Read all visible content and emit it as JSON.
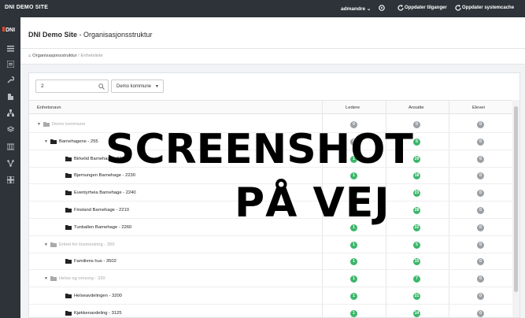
{
  "topbar": {
    "site": "DNI DEMO SITE",
    "user": "admandre ⌄",
    "update_access": "Oppdater tilganger",
    "update_cache": "Oppdater systemcache"
  },
  "sidebar": {
    "logo": "DNI"
  },
  "header": {
    "title_bold": "DNI Demo Site",
    "title_rest": " - Organisasjonsstruktur"
  },
  "breadcrumb": {
    "item1": "Organisasjonsstruktur",
    "separator": "/",
    "item2": "Enhetsliste"
  },
  "filter": {
    "search_value": "2",
    "select_value": "Demo kommune",
    "select_caret": "▼"
  },
  "table": {
    "headers": [
      "Enhetsnavn",
      "Ledere",
      "Ansatte",
      "Elever"
    ],
    "rows": [
      {
        "caret": "▼",
        "label": "Demo kommune",
        "muted": true,
        "ledere": "0",
        "ansatte": "0",
        "elever": "0",
        "ledere_green": false,
        "ansatte_green": false
      },
      {
        "caret": "▼",
        "label": "Barnehagene - 255",
        "muted": false,
        "ledere": "0",
        "ansatte": "6",
        "elever": "0",
        "ledere_green": false,
        "ansatte_green": true
      },
      {
        "caret": "",
        "label": "Birkelid Barnehage - 2270",
        "muted": false,
        "ledere": "1",
        "ansatte": "29",
        "elever": "0",
        "ledere_green": true,
        "ansatte_green": true
      },
      {
        "caret": "",
        "label": "Bjørnungen Barnehage - 2230",
        "muted": false,
        "ledere": "1",
        "ansatte": "18",
        "elever": "0",
        "ledere_green": true,
        "ansatte_green": true
      },
      {
        "caret": "",
        "label": "Eventyrheia Barnehage - 2240",
        "muted": false,
        "ledere": "1",
        "ansatte": "23",
        "elever": "0",
        "ledere_green": true,
        "ansatte_green": true
      },
      {
        "caret": "",
        "label": "Finsland Barnehage - 2210",
        "muted": false,
        "ledere": "1",
        "ansatte": "28",
        "elever": "0",
        "ledere_green": true,
        "ansatte_green": true
      },
      {
        "caret": "",
        "label": "Tunballen Barnehage - 2260",
        "muted": false,
        "ledere": "1",
        "ansatte": "22",
        "elever": "0",
        "ledere_green": true,
        "ansatte_green": true
      },
      {
        "caret": "▼",
        "label": "Enhet for livsmestring - 350",
        "muted": true,
        "ledere": "1",
        "ansatte": "5",
        "elever": "0",
        "ledere_green": true,
        "ansatte_green": true
      },
      {
        "caret": "",
        "label": "Familiens hus - 3502",
        "muted": false,
        "ledere": "1",
        "ansatte": "15",
        "elever": "0",
        "ledere_green": true,
        "ansatte_green": true
      },
      {
        "caret": "▼",
        "label": "Helse og omsorg - 320",
        "muted": true,
        "ledere": "1",
        "ansatte": "7",
        "elever": "0",
        "ledere_green": true,
        "ansatte_green": true
      },
      {
        "caret": "",
        "label": "Helseavdelingen - 3200",
        "muted": false,
        "ledere": "1",
        "ansatte": "21",
        "elever": "0",
        "ledere_green": true,
        "ansatte_green": true
      },
      {
        "caret": "",
        "label": "Kjøkkenavdeling - 3125",
        "muted": false,
        "ledere": "1",
        "ansatte": "14",
        "elever": "0",
        "ledere_green": true,
        "ansatte_green": true
      }
    ]
  },
  "overlay": {
    "line1": "SCREENSHOT",
    "line2": "PÅ VEJ"
  },
  "colors": {
    "dark": "#2d3338",
    "green": "#3cb66b",
    "gray": "#9aa0a6"
  },
  "icons": {
    "sidebar": [
      "dashboard-icon",
      "list-icon",
      "wrench-icon",
      "building-icon",
      "org-chart-icon",
      "layers-icon",
      "table-icon",
      "network-icon",
      "grid-icon"
    ],
    "top": [
      "settings-icon",
      "refresh-icon",
      "refresh-icon"
    ]
  }
}
